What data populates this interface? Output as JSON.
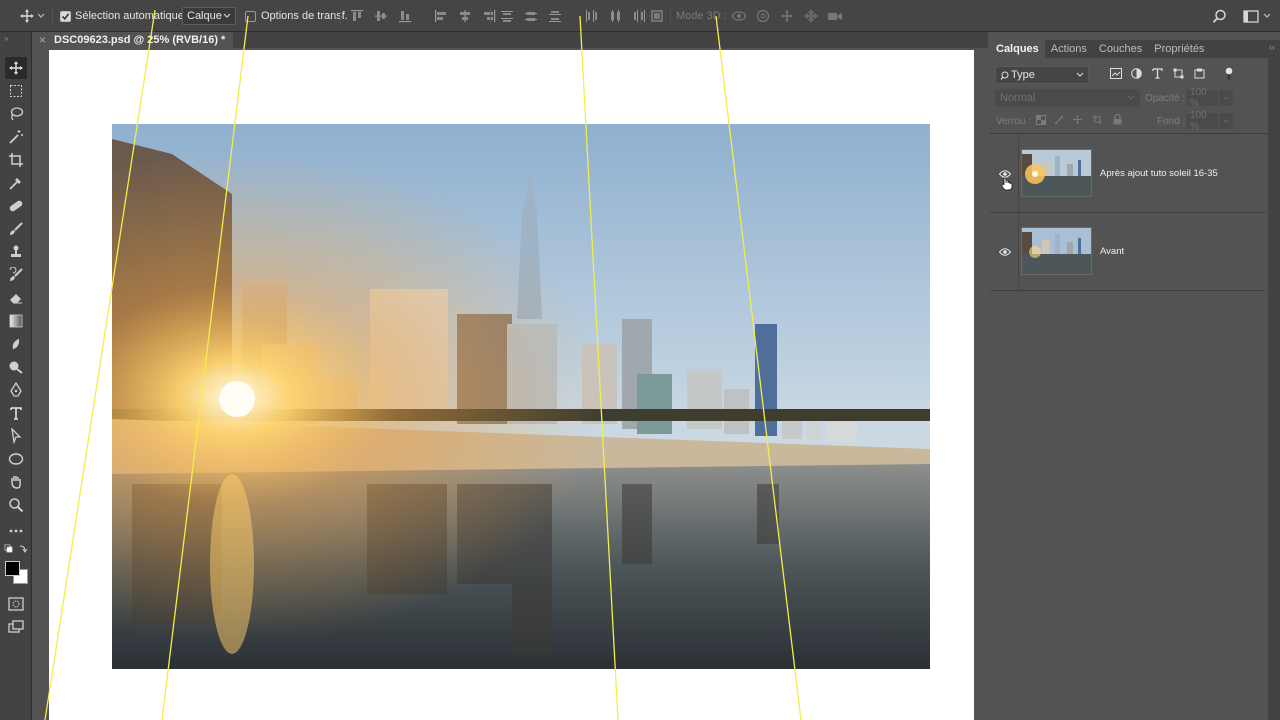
{
  "options_bar": {
    "auto_select_label": "Sélection automatique :",
    "auto_select_checked": true,
    "auto_select_target": "Calque",
    "transform_label": "Options de transf.",
    "transform_checked": false,
    "mode3d_label": "Mode 3D :"
  },
  "document": {
    "tab_title": "DSC09623.psd @ 25% (RVB/16) *",
    "close_glyph": "×"
  },
  "panel": {
    "tabs": [
      "Calques",
      "Actions",
      "Couches",
      "Propriétés"
    ],
    "active_tab": "Calques",
    "filter_label": "Type",
    "blend_mode": "Normal",
    "opacity_label": "Opacité :",
    "opacity_value": "100 %",
    "lock_label": "Verrou :",
    "fill_label": "Fond :",
    "fill_value": "100 %",
    "layers": [
      {
        "name": "Après ajout tuto soleil 16-35",
        "visible": true,
        "variant": "after"
      },
      {
        "name": "Avant",
        "visible": true,
        "variant": "before"
      }
    ]
  },
  "colors": {
    "guide": "#f2ee4a",
    "ui_dark": "#454545",
    "ui_mid": "#535353",
    "accent_sun": "#ffb640"
  },
  "icons": {
    "move_tool": "move-icon",
    "search": "search-icon",
    "workspace": "workspace-icon"
  }
}
